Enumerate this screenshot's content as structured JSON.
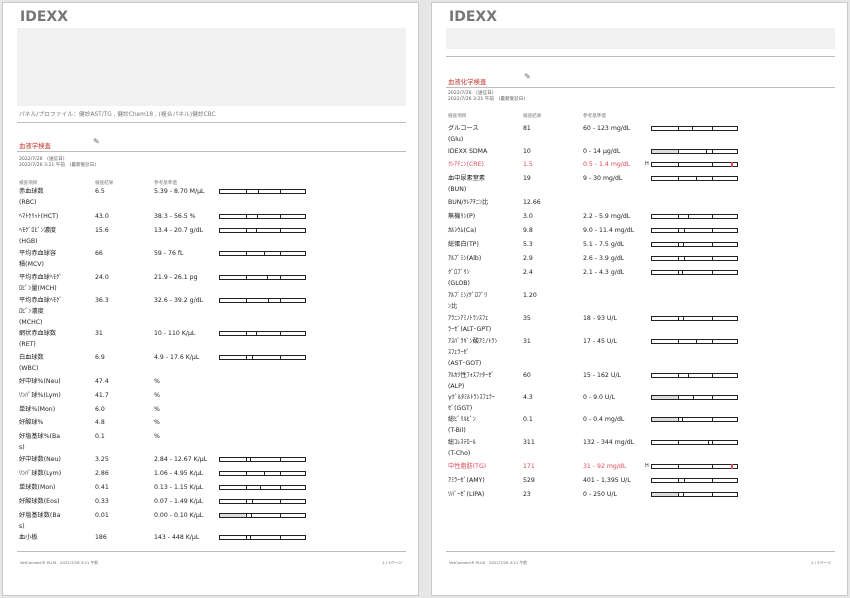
{
  "brand": "IDEXX",
  "page1": {
    "panel_line": "パネル/プロファイル：健診AST/TG , 健診Chem18 , (複合パネル)健診CBC",
    "section_title": "血液学検査",
    "date1": "2022/7/26　(送信日)",
    "date2": "2022/7/26 3:21 午前　(最新受診日)",
    "col_item": "検査項目",
    "col_result": "検査結果",
    "col_range": "参考基準値",
    "footer": "VetConnect® PLUS　2022/7/26 3:21 午前",
    "page_no": "1 / 2ページ",
    "rows": [
      {
        "name": "赤血球数\n(RBC)",
        "value": "6.5",
        "range": "5.39 - 8.70 M/μL",
        "bar": true,
        "pos": 0.45
      },
      {
        "name": "ﾍﾏﾄｸﾘｯﾄ(HCT)",
        "value": "43.0",
        "range": "38.3 - 56.5 %",
        "bar": true,
        "pos": 0.44
      },
      {
        "name": "ﾍﾓｸﾞﾛﾋﾞﾝ濃度\n(HGB)",
        "value": "15.6",
        "range": "13.4 - 20.7 g/dL",
        "bar": true,
        "pos": 0.42
      },
      {
        "name": "平均赤血球容\n積(MCV)",
        "value": "66",
        "range": "59 - 76 fL",
        "bar": true,
        "pos": 0.52
      },
      {
        "name": "平均赤血球ﾍﾓｸﾞ\nﾛﾋﾞﾝ量(MCH)",
        "value": "24.0",
        "range": "21.9 - 26.1 pg",
        "bar": true,
        "pos": 0.55
      },
      {
        "name": "平均赤血球ﾍﾓｸﾞ\nﾛﾋﾞﾝ濃度\n(MCHC)",
        "value": "36.3",
        "range": "32.6 - 39.2 g/dL",
        "bar": true,
        "pos": 0.57
      },
      {
        "name": "網状赤血球数\n(RET)",
        "value": "31",
        "range": "10 - 110 K/μL",
        "bar": true,
        "pos": 0.42
      },
      {
        "name": "白血球数\n(WBC)",
        "value": "6.9",
        "range": "4.9 - 17.6 K/μL",
        "bar": true,
        "pos": 0.38
      },
      {
        "name": "好中球%(Neu)",
        "value": "47.4",
        "range": "%",
        "bar": false
      },
      {
        "name": "ﾘﾝﾊﾟ球%(Lym)",
        "value": "41.7",
        "range": "%",
        "bar": false
      },
      {
        "name": "単球%(Mon)",
        "value": "6.0",
        "range": "%",
        "bar": false
      },
      {
        "name": "好酸球%",
        "value": "4.8",
        "range": "%",
        "bar": false
      },
      {
        "name": "好塩基球%(Ba\ns)",
        "value": "0.1",
        "range": "%",
        "bar": false
      },
      {
        "name": "好中球数(Neu)",
        "value": "3.25",
        "range": "2.84 - 12.67 K/μL",
        "bar": true,
        "pos": 0.35
      },
      {
        "name": "ﾘﾝﾊﾟ球数(Lym)",
        "value": "2.86",
        "range": "1.06 - 4.95 K/μL",
        "bar": true,
        "pos": 0.52
      },
      {
        "name": "単球数(Mon)",
        "value": "0.41",
        "range": "0.13 - 1.15 K/μL",
        "bar": true,
        "pos": 0.47
      },
      {
        "name": "好酸球数(Eos)",
        "value": "0.33",
        "range": "0.07 - 1.49 K/μL",
        "bar": true,
        "pos": 0.38
      },
      {
        "name": "好塩基球数(Ba\ns)",
        "value": "0.01",
        "range": "0.00 - 0.10 K/μL",
        "bar": true,
        "pos": 0.36,
        "low": true
      },
      {
        "name": "血小板",
        "value": "186",
        "range": "143 - 448 K/μL",
        "bar": true,
        "pos": 0.35
      }
    ]
  },
  "page2": {
    "section_title": "血液化学検査",
    "date1": "2022/7/26　(送信日)",
    "date2": "2022/7/26 3:21 午前　(最新受診日)",
    "col_item": "検査項目",
    "col_result": "検査結果",
    "col_range": "参考基準値",
    "footer": "VetConnect® PLUS　2022/7/26 3:21 午前",
    "page_no": "2 / 2ページ",
    "rows": [
      {
        "name": "グルコース\n(Glu)",
        "value": "81",
        "range": "60 - 123 mg/dL",
        "bar": true,
        "pos": 0.47
      },
      {
        "name": "IDEXX SDMA",
        "value": "10",
        "range": "0 - 14 μg/dL",
        "bar": true,
        "pos": 0.63,
        "low": true
      },
      {
        "name": "ｸﾚｱﾁﾆﾝ(CRE)",
        "value": "1.5",
        "range": "0.5 - 1.4 mg/dL",
        "bar": true,
        "pos": 0.93,
        "high": true,
        "abn": true
      },
      {
        "name": "血中尿素窒素\n(BUN)",
        "value": "19",
        "range": "9 - 30 mg/dL",
        "bar": true,
        "pos": 0.52
      },
      {
        "name": "BUN/ｸﾚｱﾁﾆﾝ比",
        "value": "12.66",
        "range": "",
        "bar": false
      },
      {
        "name": "無機ﾘﾝ(P)",
        "value": "3.0",
        "range": "2.2 - 5.9 mg/dL",
        "bar": true,
        "pos": 0.42
      },
      {
        "name": "ｶﾙｼｳﾑ(Ca)",
        "value": "9.8",
        "range": "9.0 - 11.4 mg/dL",
        "bar": true,
        "pos": 0.38
      },
      {
        "name": "総蛋白(TP)",
        "value": "5.3",
        "range": "5.1 - 7.5 g/dL",
        "bar": true,
        "pos": 0.36
      },
      {
        "name": "ｱﾙﾌﾞﾐﾝ(Alb)",
        "value": "2.9",
        "range": "2.6 - 3.9 g/dL",
        "bar": true,
        "pos": 0.38
      },
      {
        "name": "ｸﾞﾛﾌﾞﾘﾝ\n(GLOB)",
        "value": "2.4",
        "range": "2.1 - 4.3 g/dL",
        "bar": true,
        "pos": 0.35
      },
      {
        "name": "ｱﾙﾌﾞﾐﾝ/ｸﾞﾛﾌﾞﾘ\nﾝ比",
        "value": "1.20",
        "range": "",
        "bar": false
      },
      {
        "name": "ｱﾗﾆﾝｱﾐﾉﾄﾗﾝｽﾌｪ\nﾗｰｾﾞ(ALT･GPT)",
        "value": "35",
        "range": "18 - 93 U/L",
        "bar": true,
        "pos": 0.36
      },
      {
        "name": "ｱｽﾊﾟﾗｷﾞﾝ酸ｱﾐﾉﾄﾗﾝ\nｽﾌｪﾗｰｾﾞ\n(AST･GOT)",
        "value": "31",
        "range": "17 - 45 U/L",
        "bar": true,
        "pos": 0.52
      },
      {
        "name": "ｱﾙｶﾘ性ﾌｫｽﾌｧﾀｰｾﾞ\n(ALP)",
        "value": "60",
        "range": "15 - 162 U/L",
        "bar": true,
        "pos": 0.42
      },
      {
        "name": "γｸﾞﾙﾀﾐﾙﾄﾗﾝｽﾌｪﾗｰ\nｾﾞ(GGT)",
        "value": "4.3",
        "range": "0 - 9.0 U/L",
        "bar": true,
        "pos": 0.48,
        "low": true
      },
      {
        "name": "総ﾋﾞﾘﾙﾋﾞﾝ\n(T-Bil)",
        "value": "0.1",
        "range": "0 - 0.4 mg/dL",
        "bar": true,
        "pos": 0.35,
        "low": true
      },
      {
        "name": "総ｺﾚｽﾃﾛｰﾙ\n(T-Cho)",
        "value": "311",
        "range": "132 - 344 mg/dL",
        "bar": true,
        "pos": 0.66
      },
      {
        "name": "中性脂肪(TG)",
        "value": "171",
        "range": "31 - 92 mg/dL",
        "bar": true,
        "pos": 0.93,
        "high": true,
        "abn": true
      },
      {
        "name": "ｱﾐﾗｰｾﾞ(AMY)",
        "value": "529",
        "range": "401 - 1,395 U/L",
        "bar": true,
        "pos": 0.38
      },
      {
        "name": "ﾘﾊﾟｰｾﾞ(LIPA)",
        "value": "23",
        "range": "0 - 250 U/L",
        "bar": true,
        "pos": 0.36,
        "low": true
      }
    ]
  },
  "icons": {
    "pen": "pen-icon"
  },
  "colors": {
    "abnormal": "#e0495a",
    "section_title": "#c0392b"
  },
  "high_flag": "H"
}
